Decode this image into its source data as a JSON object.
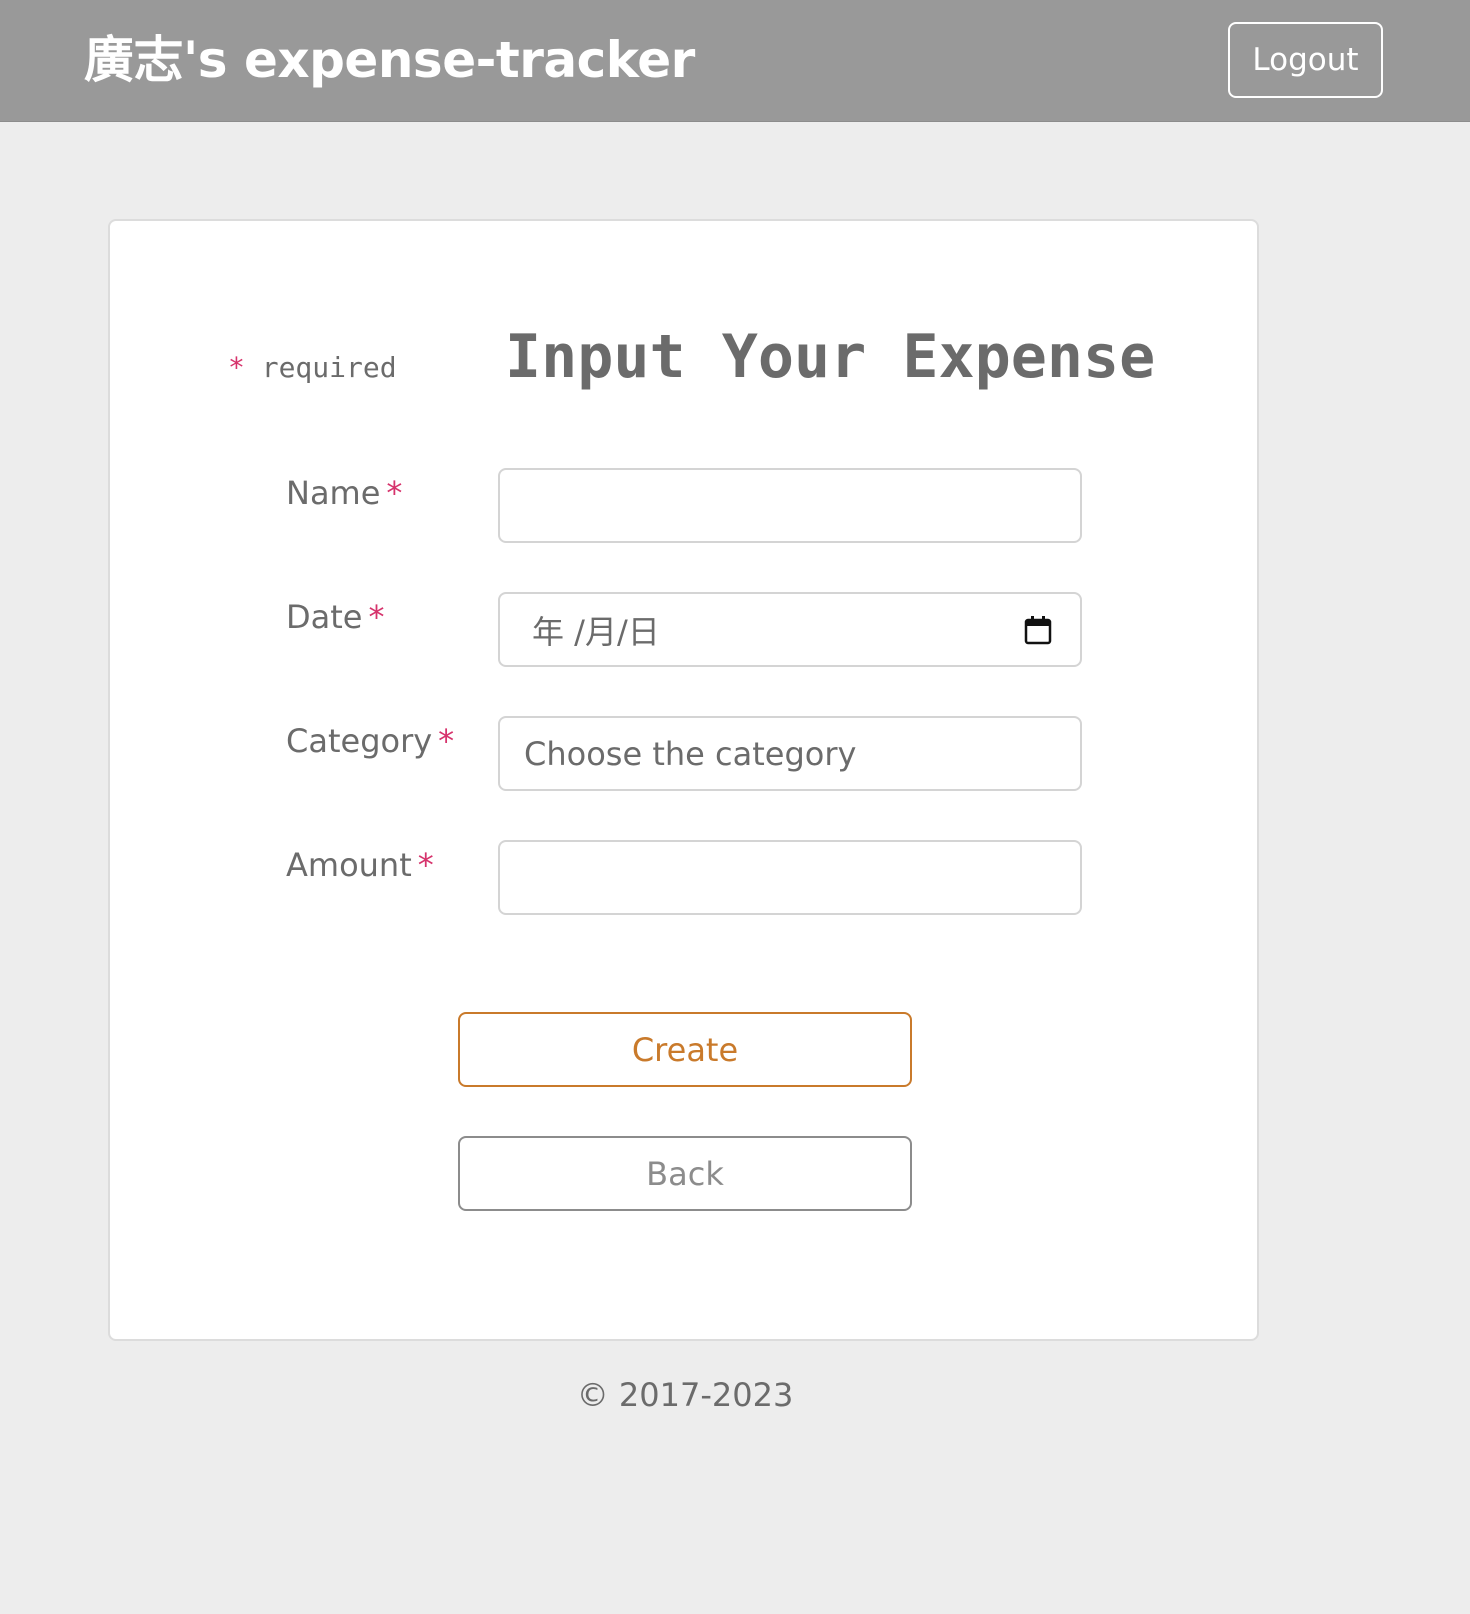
{
  "navbar": {
    "brand": "廣志's expense-tracker",
    "logout_label": "Logout"
  },
  "form": {
    "required_star": "*",
    "required_text": "required",
    "title": "Input Your Expense",
    "fields": {
      "name": {
        "label": "Name",
        "value": ""
      },
      "date": {
        "label": "Date",
        "value": "年 /月/日"
      },
      "category": {
        "label": "Category",
        "value": "Choose the category"
      },
      "amount": {
        "label": "Amount",
        "value": ""
      }
    },
    "required_mark": "*",
    "create_label": "Create",
    "back_label": "Back"
  },
  "footer": {
    "copyright": "© 2017-2023"
  },
  "colors": {
    "navbar_bg": "#999999",
    "page_bg": "#ededed",
    "required_star": "#d6336c",
    "create_accent": "#c97a2b",
    "back_border": "#8c8c8c"
  },
  "icons": {
    "date": "calendar-icon"
  }
}
